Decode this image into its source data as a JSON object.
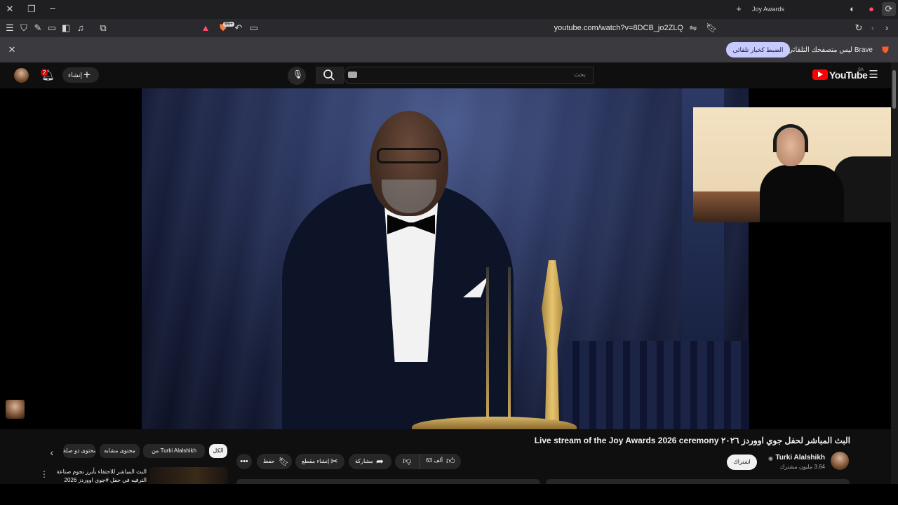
{
  "browser": {
    "tab_title": "Joy Awards",
    "url": "youtube.com/watch?v=8DCB_jo2ZLQ",
    "infobar_text": "Brave ليس متصفحك التلقائي.",
    "infobar_button": "الضبط كخيار تلقائي",
    "extension_badge": "99+"
  },
  "youtube": {
    "logo_text": "YouTube",
    "region": "SA",
    "search_placeholder": "بحث",
    "create_label": "إنشاء",
    "notification_count": "2"
  },
  "video": {
    "title": "Live stream of the Joy Awards 2026 ceremony البث المباشر لحفل جوي اووردز ٢٠٢٦",
    "channel": "Turki Alalshikh",
    "subscribers": "3.64 مليون مشترك",
    "subscribe_label": "اشتراك",
    "likes": "63 ألف",
    "share_label": "مشاركة",
    "clip_label": "إنشاء مقطع",
    "save_label": "حفظ"
  },
  "chips": [
    "الكل",
    "من Turki Alalshikh",
    "محتوى مشابه",
    "محتوى ذو صلة"
  ],
  "related": {
    "title_line1": "البث المباشر للاحتفاء بأبرز نجوم صناعة",
    "title_line2": "الترفيه في حفل #جوي اووردز 2026"
  },
  "colors": {
    "brand_red": "#ff0000",
    "infobar_button": "#c7c9ff",
    "background": "#0f0f0f"
  }
}
